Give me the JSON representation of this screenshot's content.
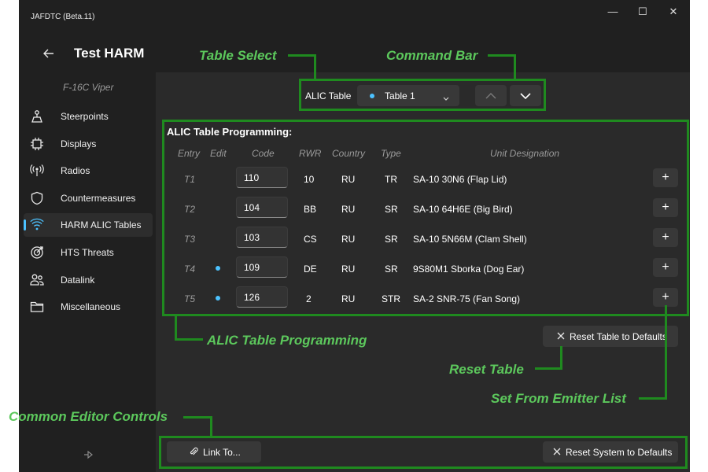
{
  "window": {
    "app_title": "JAFDTC (Beta.11)",
    "controls": {
      "minimize": "—",
      "maximize": "☐",
      "close": "✕"
    }
  },
  "header": {
    "title": "Test HARM",
    "airframe": "F-16C Viper"
  },
  "sidebar": {
    "items": [
      {
        "label": "Steerpoints",
        "icon": "steerpoint-icon"
      },
      {
        "label": "Displays",
        "icon": "chip-icon"
      },
      {
        "label": "Radios",
        "icon": "antenna-icon"
      },
      {
        "label": "Countermeasures",
        "icon": "shield-icon"
      },
      {
        "label": "HARM ALIC Tables",
        "icon": "wifi-icon",
        "selected": true
      },
      {
        "label": "HTS Threats",
        "icon": "target-icon"
      },
      {
        "label": "Datalink",
        "icon": "people-icon"
      },
      {
        "label": "Miscellaneous",
        "icon": "folder-icon"
      }
    ]
  },
  "command_bar": {
    "table_label": "ALIC Table",
    "selected_table": "Table 1"
  },
  "programming": {
    "title": "ALIC Table Programming:",
    "columns": [
      "Entry",
      "Edit",
      "Code",
      "RWR",
      "Country",
      "Type",
      "Unit Designation"
    ],
    "rows": [
      {
        "entry": "T1",
        "edited": false,
        "code": "110",
        "rwr": "10",
        "country": "RU",
        "type": "TR",
        "unit": "SA-10 30N6 (Flap Lid)"
      },
      {
        "entry": "T2",
        "edited": false,
        "code": "104",
        "rwr": "BB",
        "country": "RU",
        "type": "SR",
        "unit": "SA-10 64H6E (Big Bird)"
      },
      {
        "entry": "T3",
        "edited": false,
        "code": "103",
        "rwr": "CS",
        "country": "RU",
        "type": "SR",
        "unit": "SA-10 5N66M (Clam Shell)"
      },
      {
        "entry": "T4",
        "edited": true,
        "code": "109",
        "rwr": "DE",
        "country": "RU",
        "type": "SR",
        "unit": "9S80M1 Sborka (Dog Ear)"
      },
      {
        "entry": "T5",
        "edited": true,
        "code": "126",
        "rwr": "2",
        "country": "RU",
        "type": "STR",
        "unit": "SA-2 SNR-75 (Fan Song)"
      }
    ],
    "row_button": "+"
  },
  "buttons": {
    "reset_table": "Reset Table to Defaults",
    "link_to": "Link To...",
    "reset_system": "Reset System to Defaults"
  },
  "annotations": {
    "table_select": "Table Select",
    "command_bar": "Command Bar",
    "alic_programming": "ALIC Table Programming",
    "reset_table": "Reset Table",
    "set_from_emitter": "Set From Emitter List",
    "common_controls": "Common Editor Controls"
  },
  "colors": {
    "accent": "#4cc2ff",
    "annotation": "#1f8a1f",
    "annotation_text": "#5cc85c"
  }
}
